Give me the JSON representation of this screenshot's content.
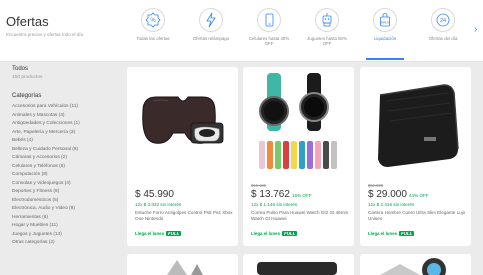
{
  "header": {
    "title": "Ofertas",
    "subtitle": "Encuentra precios y ofertas todo el día"
  },
  "categories": [
    {
      "label": "Todas las ofertas",
      "icon": "percent-badge-icon",
      "active": false
    },
    {
      "label": "Ofertas relámpago",
      "icon": "lightning-icon",
      "active": false
    },
    {
      "label": "Celulares hasta 40% OFF",
      "icon": "phone-icon",
      "active": false
    },
    {
      "label": "Juguetes hasta 50% OFF",
      "icon": "robot-icon",
      "active": false
    },
    {
      "label": "Liquidación",
      "icon": "bag-icon",
      "active": true
    },
    {
      "label": "Ofertas del día",
      "icon": "24h-icon",
      "active": false
    }
  ],
  "sidebar": {
    "heading": "Todos",
    "count": "150 productos",
    "categories_heading": "Categorías",
    "items": [
      "Accesorios para Vehículos (11)",
      "Animales y Mascotas (4)",
      "Antigüedades y Colecciones (1)",
      "Arte, Papelería y Mercería (3)",
      "Bebés (4)",
      "Belleza y Cuidado Personal (8)",
      "Cámaras y Accesorios (2)",
      "Celulares y Teléfonos (6)",
      "Computación (8)",
      "Consolas y Videojuegos (4)",
      "Deportes y Fitness (9)",
      "Electrodomésticos (5)",
      "Electrónica, Audio y Video (9)",
      "Herramientas (6)",
      "Hogar y Muebles (11)",
      "Juegos y Juguetes (14)",
      "Otras categorías (2)"
    ]
  },
  "products": [
    {
      "old_price": "",
      "price": "$ 45.990",
      "off": "",
      "installments": "12x $ 3.832 sin interés",
      "name": "Estuche Forro Antigolpes Control Ps5 Ps4 Xbox One Nintendo",
      "shipping": "Llega el lunes",
      "full": "FULL"
    },
    {
      "old_price": "$16.199",
      "price": "$ 13.762",
      "off": "15% OFF",
      "installments": "12x $ 1.146 sin interés",
      "name": "Correa Pulso Para Huawei Watch Gt2 Gt 46mm Watch Gt Huawei",
      "shipping": "Llega el lunes",
      "full": "FULL"
    },
    {
      "old_price": "$51.900",
      "price": "$ 29.000",
      "off": "44% OFF",
      "installments": "12x $ 2.416 sin interés",
      "name": "Cartera Hombre Cuero Ultra Slim Elegante Lujo Unisex",
      "shipping": "Llega el lunes",
      "full": "FULL"
    }
  ],
  "colors": {
    "accent": "#3483fa",
    "green": "#00a650",
    "background": "#ebebeb"
  }
}
